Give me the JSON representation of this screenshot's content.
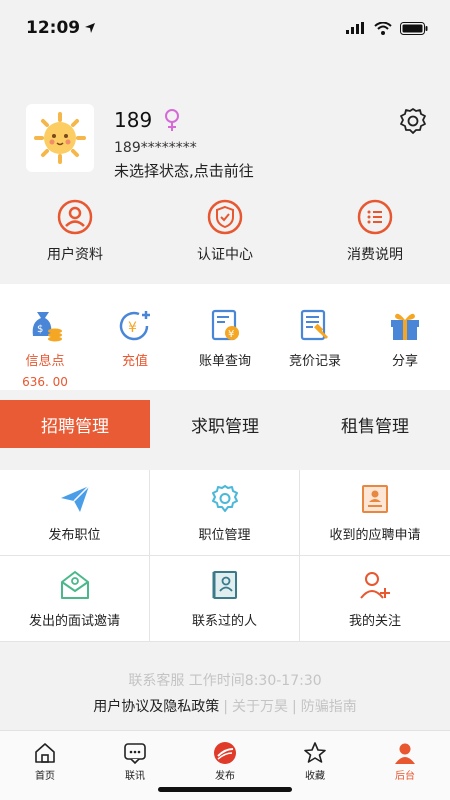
{
  "status_bar": {
    "time": "12:09"
  },
  "profile": {
    "name": "189",
    "phone": "189********",
    "status_text": "未选择状态,点击前往"
  },
  "top_menu": [
    {
      "label": "用户资料",
      "icon": "user-profile-icon"
    },
    {
      "label": "认证中心",
      "icon": "shield-check-icon"
    },
    {
      "label": "消费说明",
      "icon": "list-doc-icon"
    }
  ],
  "services": [
    {
      "label": "信息点",
      "value": "636. 00",
      "icon": "money-bag-icon"
    },
    {
      "label": "充值",
      "icon": "recharge-icon"
    },
    {
      "label": "账单查询",
      "icon": "bill-icon"
    },
    {
      "label": "竞价记录",
      "icon": "bid-record-icon"
    },
    {
      "label": "分享",
      "icon": "gift-icon"
    }
  ],
  "tabs": [
    {
      "label": "招聘管理",
      "active": true
    },
    {
      "label": "求职管理",
      "active": false
    },
    {
      "label": "租售管理",
      "active": false
    }
  ],
  "grid": [
    {
      "label": "发布职位",
      "icon": "paper-plane-icon"
    },
    {
      "label": "职位管理",
      "icon": "gear-icon"
    },
    {
      "label": "收到的应聘申请",
      "icon": "resume-icon"
    },
    {
      "label": "发出的面试邀请",
      "icon": "invite-icon"
    },
    {
      "label": "联系过的人",
      "icon": "contacts-book-icon"
    },
    {
      "label": "我的关注",
      "icon": "person-add-icon"
    }
  ],
  "footer": {
    "service_line": "联系客服  工作时间8:30-17:30",
    "link_policy": "用户协议及隐私政策",
    "link_about": "关于万昊",
    "link_fraud": "防骗指南"
  },
  "tabbar": [
    {
      "label": "首页",
      "icon": "home-icon",
      "active": false
    },
    {
      "label": "联讯",
      "icon": "chat-icon",
      "active": false
    },
    {
      "label": "发布",
      "icon": "publish-icon",
      "active": false
    },
    {
      "label": "收藏",
      "icon": "star-icon",
      "active": false
    },
    {
      "label": "后台",
      "icon": "person-icon",
      "active": true
    }
  ],
  "colors": {
    "accent": "#e85b34",
    "background": "#f2f2f2",
    "link_gray": "#c4c4c4"
  }
}
